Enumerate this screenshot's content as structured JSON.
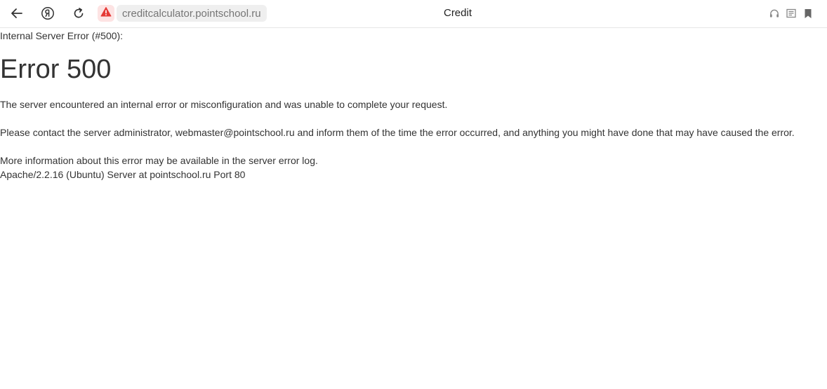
{
  "browser": {
    "address": "creditcalculator.pointschool.ru",
    "tab_title": "Credit",
    "icons": [
      "back-arrow-icon",
      "yandex-icon",
      "reload-icon",
      "warning-icon",
      "headphones-icon",
      "reader-mode-icon",
      "bookmark-icon"
    ],
    "colors": {
      "warning": "#e53935",
      "warning_bg": "#fde3e3",
      "address_bg": "#efefef"
    }
  },
  "page": {
    "error_label": "Internal Server Error (#500):",
    "heading": "Error 500",
    "paragraph_1": "The server encountered an internal error or misconfiguration and was unable to complete your request.",
    "paragraph_2": "Please contact the server administrator, webmaster@pointschool.ru and inform them of the time the error occurred, and anything you might have done that may have caused the error.",
    "paragraph_3": "More information about this error may be available in the server error log.",
    "server_signature": "Apache/2.2.16 (Ubuntu) Server at pointschool.ru Port 80"
  }
}
